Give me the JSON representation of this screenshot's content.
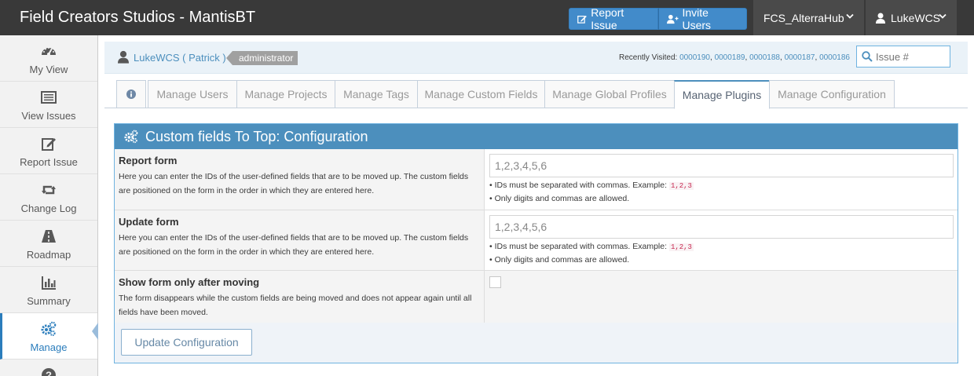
{
  "navbar": {
    "brand": "Field Creators Studios - MantisBT",
    "report_issue": "Report Issue",
    "invite_users": "Invite Users",
    "project": "FCS_AlterraHub",
    "user": "LukeWCS"
  },
  "sidebar": {
    "items": [
      {
        "label": "My View",
        "icon": "dashboard-icon"
      },
      {
        "label": "View Issues",
        "icon": "list-icon"
      },
      {
        "label": "Report Issue",
        "icon": "edit-icon"
      },
      {
        "label": "Change Log",
        "icon": "retweet-icon"
      },
      {
        "label": "Roadmap",
        "icon": "road-icon"
      },
      {
        "label": "Summary",
        "icon": "bar-chart-icon"
      },
      {
        "label": "Manage",
        "icon": "gears-icon"
      }
    ],
    "active": "Manage"
  },
  "breadcrumb": {
    "user": "LukeWCS ( Patrick )",
    "role": "administrator",
    "recent_label": "Recently Visited:",
    "recent_ids": [
      "0000190",
      "0000189",
      "0000188",
      "0000187",
      "0000186"
    ],
    "search_placeholder": "Issue #"
  },
  "tabs": [
    {
      "label": "",
      "icon": "info-icon"
    },
    {
      "label": "Manage Users"
    },
    {
      "label": "Manage Projects"
    },
    {
      "label": "Manage Tags"
    },
    {
      "label": "Manage Custom Fields"
    },
    {
      "label": "Manage Global Profiles"
    },
    {
      "label": "Manage Plugins"
    },
    {
      "label": "Manage Configuration"
    }
  ],
  "active_tab": "Manage Plugins",
  "panel": {
    "title": "Custom fields To Top: Configuration",
    "rows": [
      {
        "title": "Report form",
        "desc": "Here you can enter the IDs of the user-defined fields that are to be moved up. The custom fields are positioned on the form in the order in which they are entered here.",
        "value": "1,2,3,4,5,6",
        "hint1": "• IDs must be separated with commas. Example:",
        "hint_code": "1,2,3",
        "hint2": "• Only digits and commas are allowed."
      },
      {
        "title": "Update form",
        "desc": "Here you can enter the IDs of the user-defined fields that are to be moved up. The custom fields are positioned on the form in the order in which they are entered here.",
        "value": "1,2,3,4,5,6",
        "hint1": "• IDs must be separated with commas. Example:",
        "hint_code": "1,2,3",
        "hint2": "• Only digits and commas are allowed."
      },
      {
        "title": "Show form only after moving",
        "desc": "The form disappears while the custom fields are being moved and does not appear again until all fields have been moved.",
        "checked": false
      }
    ],
    "submit": "Update Configuration"
  }
}
